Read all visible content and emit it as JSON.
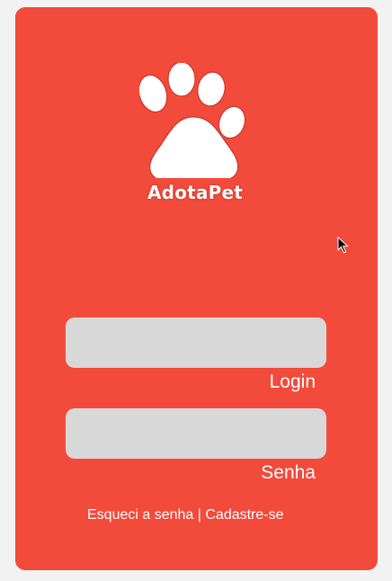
{
  "brand": {
    "name": "AdotaPet",
    "logo_icon": "paw-icon"
  },
  "form": {
    "login_label": "Login",
    "password_label": "Senha",
    "login_value": "",
    "password_value": ""
  },
  "links": {
    "forgot": "Esqueci a senha",
    "separator": " | ",
    "signup": "Cadastre-se"
  },
  "colors": {
    "page_background": "#f2f2f2",
    "card_background": "#f24a3b",
    "field_background": "#d8d8d8",
    "text": "#ffffff"
  }
}
